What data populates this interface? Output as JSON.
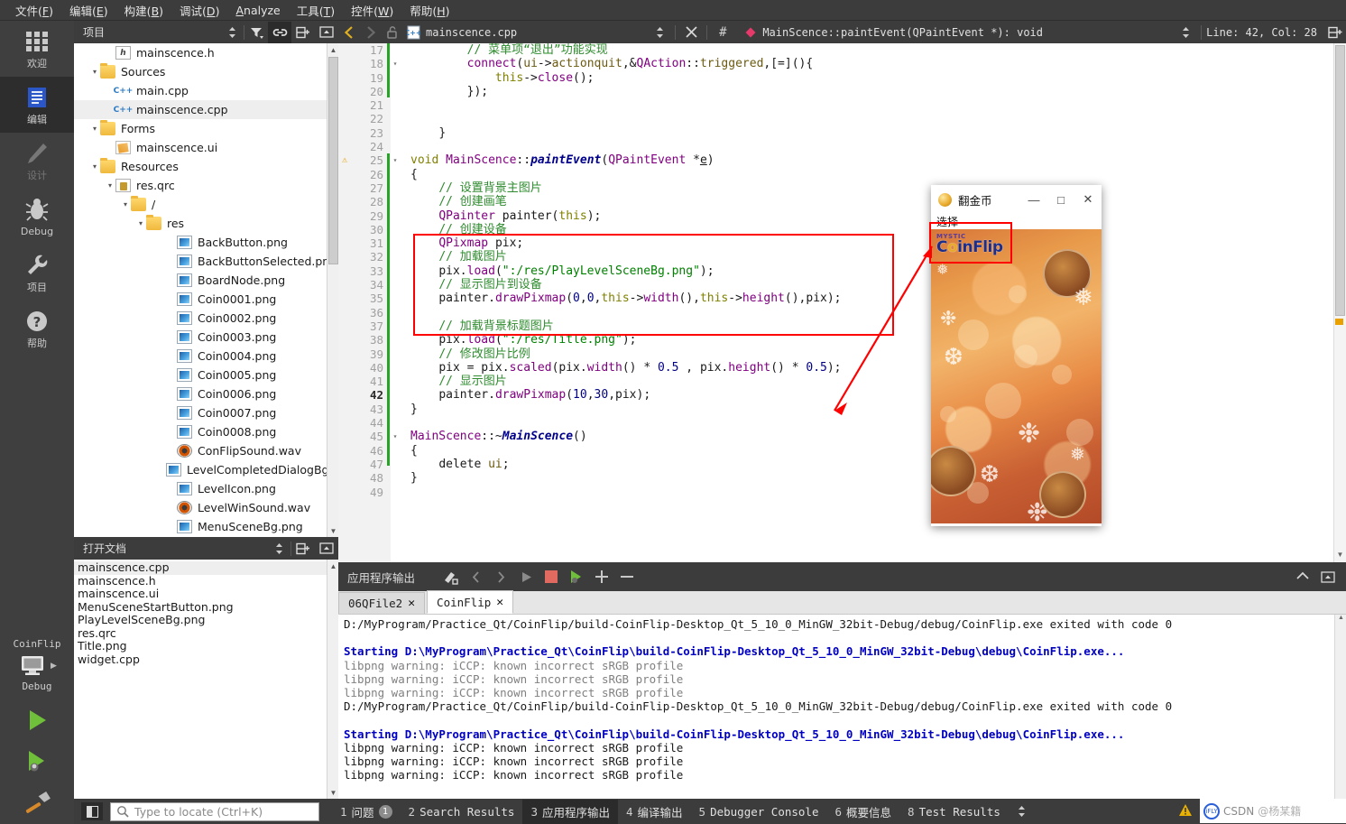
{
  "menubar": {
    "items": [
      {
        "label": "文件(F)",
        "accel": "F"
      },
      {
        "label": "编辑(E)",
        "accel": "E"
      },
      {
        "label": "构建(B)",
        "accel": "B"
      },
      {
        "label": "调试(D)",
        "accel": "D"
      },
      {
        "label": "Analyze",
        "accel": "A"
      },
      {
        "label": "工具(T)",
        "accel": "T"
      },
      {
        "label": "控件(W)",
        "accel": "W"
      },
      {
        "label": "帮助(H)",
        "accel": "H"
      }
    ]
  },
  "activitybar": {
    "items": [
      {
        "label": "欢迎",
        "icon": "grid-icon",
        "active": false,
        "dim": false
      },
      {
        "label": "编辑",
        "icon": "document-icon",
        "active": true,
        "dim": false
      },
      {
        "label": "设计",
        "icon": "pencil-icon",
        "active": false,
        "dim": true
      },
      {
        "label": "Debug",
        "icon": "bug-icon",
        "active": false,
        "dim": false
      },
      {
        "label": "项目",
        "icon": "wrench-icon",
        "active": false,
        "dim": false
      },
      {
        "label": "帮助",
        "icon": "question-icon",
        "active": false,
        "dim": false
      }
    ],
    "kit_name": "CoinFlip",
    "build_config": "Debug",
    "run_label": "run-button",
    "debug_label": "debug-button",
    "build_label": "build-button"
  },
  "project_panel": {
    "title": "项目",
    "tree": [
      {
        "indent": 2,
        "arrow": "",
        "icon": "header-icon",
        "label": "mainscence.h",
        "selected": false
      },
      {
        "indent": 1,
        "arrow": "▾",
        "icon": "folder-cpp-icon",
        "label": "Sources",
        "selected": false
      },
      {
        "indent": 2,
        "arrow": "",
        "icon": "cpp-icon",
        "label": "main.cpp",
        "selected": false
      },
      {
        "indent": 2,
        "arrow": "",
        "icon": "cpp-icon",
        "label": "mainscence.cpp",
        "selected": true
      },
      {
        "indent": 1,
        "arrow": "▾",
        "icon": "folder-form-icon",
        "label": "Forms",
        "selected": false
      },
      {
        "indent": 2,
        "arrow": "",
        "icon": "ui-icon",
        "label": "mainscence.ui",
        "selected": false
      },
      {
        "indent": 1,
        "arrow": "▾",
        "icon": "folder-res-icon",
        "label": "Resources",
        "selected": false
      },
      {
        "indent": 2,
        "arrow": "▾",
        "icon": "qrc-icon",
        "label": "res.qrc",
        "selected": false
      },
      {
        "indent": 3,
        "arrow": "▾",
        "icon": "folder-icon",
        "label": "/",
        "selected": false
      },
      {
        "indent": 4,
        "arrow": "▾",
        "icon": "folder-icon",
        "label": "res",
        "selected": false
      },
      {
        "indent": 6,
        "arrow": "",
        "icon": "png-icon",
        "label": "BackButton.png",
        "selected": false
      },
      {
        "indent": 6,
        "arrow": "",
        "icon": "png-icon",
        "label": "BackButtonSelected.png",
        "selected": false
      },
      {
        "indent": 6,
        "arrow": "",
        "icon": "png-icon",
        "label": "BoardNode.png",
        "selected": false
      },
      {
        "indent": 6,
        "arrow": "",
        "icon": "png-icon",
        "label": "Coin0001.png",
        "selected": false
      },
      {
        "indent": 6,
        "arrow": "",
        "icon": "png-icon",
        "label": "Coin0002.png",
        "selected": false
      },
      {
        "indent": 6,
        "arrow": "",
        "icon": "png-icon",
        "label": "Coin0003.png",
        "selected": false
      },
      {
        "indent": 6,
        "arrow": "",
        "icon": "png-icon",
        "label": "Coin0004.png",
        "selected": false
      },
      {
        "indent": 6,
        "arrow": "",
        "icon": "png-icon",
        "label": "Coin0005.png",
        "selected": false
      },
      {
        "indent": 6,
        "arrow": "",
        "icon": "png-icon",
        "label": "Coin0006.png",
        "selected": false
      },
      {
        "indent": 6,
        "arrow": "",
        "icon": "png-icon",
        "label": "Coin0007.png",
        "selected": false
      },
      {
        "indent": 6,
        "arrow": "",
        "icon": "png-icon",
        "label": "Coin0008.png",
        "selected": false
      },
      {
        "indent": 6,
        "arrow": "",
        "icon": "wav-icon",
        "label": "ConFlipSound.wav",
        "selected": false
      },
      {
        "indent": 6,
        "arrow": "",
        "icon": "png-icon",
        "label": "LevelCompletedDialogBg.png",
        "selected": false
      },
      {
        "indent": 6,
        "arrow": "",
        "icon": "png-icon",
        "label": "LevelIcon.png",
        "selected": false
      },
      {
        "indent": 6,
        "arrow": "",
        "icon": "wav-icon",
        "label": "LevelWinSound.wav",
        "selected": false
      },
      {
        "indent": 6,
        "arrow": "",
        "icon": "png-icon",
        "label": "MenuSceneBg.png",
        "selected": false
      }
    ]
  },
  "open_documents": {
    "title": "打开文档",
    "items": [
      {
        "label": "mainscence.cpp",
        "selected": true
      },
      {
        "label": "mainscence.h",
        "selected": false
      },
      {
        "label": "mainscence.ui",
        "selected": false
      },
      {
        "label": "MenuSceneStartButton.png",
        "selected": false
      },
      {
        "label": "PlayLevelSceneBg.png",
        "selected": false
      },
      {
        "label": "res.qrc",
        "selected": false
      },
      {
        "label": "Title.png",
        "selected": false
      },
      {
        "label": "widget.cpp",
        "selected": false
      }
    ]
  },
  "editor": {
    "file_name": "mainscence.cpp",
    "symbol": "MainScence::paintEvent(QPaintEvent *): void",
    "cursor": "Line: 42, Col: 28",
    "lines": [
      {
        "n": 17,
        "fold": "",
        "warn": false,
        "current": false,
        "html": "        <span class=\"cmt\">// 菜单项“退出”功能实现</span>"
      },
      {
        "n": 18,
        "fold": "▾",
        "warn": false,
        "current": false,
        "html": "        <span class=\"typ\">connect</span><span class=\"plain\">(</span><span class=\"var\">ui</span><span class=\"plain\">-&gt;</span><span class=\"var\">actionquit</span><span class=\"plain\">,&amp;</span><span class=\"cls\">QAction</span><span class=\"plain\">::</span><span class=\"var\">triggered</span><span class=\"plain\">,[=](){</span>"
      },
      {
        "n": 19,
        "fold": "",
        "warn": false,
        "current": false,
        "html": "            <span class=\"kw\">this</span><span class=\"plain\">-&gt;</span><span class=\"typ\">close</span><span class=\"plain\">();</span>"
      },
      {
        "n": 20,
        "fold": "",
        "warn": false,
        "current": false,
        "html": "        <span class=\"plain\">});</span>"
      },
      {
        "n": 21,
        "fold": "",
        "warn": false,
        "current": false,
        "html": ""
      },
      {
        "n": 22,
        "fold": "",
        "warn": false,
        "current": false,
        "html": ""
      },
      {
        "n": 23,
        "fold": "",
        "warn": false,
        "current": false,
        "html": "    <span class=\"plain\">}</span>"
      },
      {
        "n": 24,
        "fold": "",
        "warn": false,
        "current": false,
        "html": ""
      },
      {
        "n": 25,
        "fold": "▾",
        "warn": true,
        "current": false,
        "html": "<span class=\"kw\">void</span> <span class=\"cls\">MainScence</span><span class=\"plain\">::</span><span class=\"fnb\">paintEvent</span><span class=\"plain\">(</span><span class=\"cls\">QPaintEvent</span> <span class=\"plain\">*</span><span class=\"uline\">e</span><span class=\"plain\">)</span>"
      },
      {
        "n": 26,
        "fold": "",
        "warn": false,
        "current": false,
        "html": "<span class=\"plain\">{</span>"
      },
      {
        "n": 27,
        "fold": "",
        "warn": false,
        "current": false,
        "html": "    <span class=\"cmt\">// 设置背景主图片</span>"
      },
      {
        "n": 28,
        "fold": "",
        "warn": false,
        "current": false,
        "html": "    <span class=\"cmt\">// 创建画笔</span>"
      },
      {
        "n": 29,
        "fold": "",
        "warn": false,
        "current": false,
        "html": "    <span class=\"cls\">QPainter</span> <span class=\"plain\">painter(</span><span class=\"kw\">this</span><span class=\"plain\">);</span>"
      },
      {
        "n": 30,
        "fold": "",
        "warn": false,
        "current": false,
        "html": "    <span class=\"cmt\">// 创建设备</span>"
      },
      {
        "n": 31,
        "fold": "",
        "warn": false,
        "current": false,
        "html": "    <span class=\"cls\">QPixmap</span> <span class=\"plain\">pix;</span>"
      },
      {
        "n": 32,
        "fold": "",
        "warn": false,
        "current": false,
        "html": "    <span class=\"cmt\">// 加载图片</span>"
      },
      {
        "n": 33,
        "fold": "",
        "warn": false,
        "current": false,
        "html": "    <span class=\"plain\">pix.</span><span class=\"typ\">load</span><span class=\"plain\">(</span><span class=\"str\">\":/res/PlayLevelSceneBg.png\"</span><span class=\"plain\">);</span>"
      },
      {
        "n": 34,
        "fold": "",
        "warn": false,
        "current": false,
        "html": "    <span class=\"cmt\">// 显示图片到设备</span>"
      },
      {
        "n": 35,
        "fold": "",
        "warn": false,
        "current": false,
        "html": "    <span class=\"plain\">painter.</span><span class=\"typ\">drawPixmap</span><span class=\"plain\">(</span><span class=\"num\">0</span><span class=\"plain\">,</span><span class=\"num\">0</span><span class=\"plain\">,</span><span class=\"kw\">this</span><span class=\"plain\">-&gt;</span><span class=\"typ\">width</span><span class=\"plain\">(),</span><span class=\"kw\">this</span><span class=\"plain\">-&gt;</span><span class=\"typ\">height</span><span class=\"plain\">(),pix);</span>"
      },
      {
        "n": 36,
        "fold": "",
        "warn": false,
        "current": false,
        "html": ""
      },
      {
        "n": 37,
        "fold": "",
        "warn": false,
        "current": false,
        "html": "    <span class=\"cmt\">// 加载背景标题图片</span>"
      },
      {
        "n": 38,
        "fold": "",
        "warn": false,
        "current": false,
        "html": "    <span class=\"plain\">pix.</span><span class=\"typ\">load</span><span class=\"plain\">(</span><span class=\"str\">\":/res/Title.png\"</span><span class=\"plain\">);</span>"
      },
      {
        "n": 39,
        "fold": "",
        "warn": false,
        "current": false,
        "html": "    <span class=\"cmt\">// 修改图片比例</span>"
      },
      {
        "n": 40,
        "fold": "",
        "warn": false,
        "current": false,
        "html": "    <span class=\"plain\">pix = pix.</span><span class=\"typ\">scaled</span><span class=\"plain\">(pix.</span><span class=\"typ\">width</span><span class=\"plain\">() * </span><span class=\"num\">0.5</span><span class=\"plain\"> , pix.</span><span class=\"typ\">height</span><span class=\"plain\">() * </span><span class=\"num\">0.5</span><span class=\"plain\">);</span>"
      },
      {
        "n": 41,
        "fold": "",
        "warn": false,
        "current": false,
        "html": "    <span class=\"cmt\">// 显示图片</span>"
      },
      {
        "n": 42,
        "fold": "",
        "warn": false,
        "current": true,
        "html": "    <span class=\"plain\">painter.</span><span class=\"typ\">drawPixmap</span><span class=\"plain\">(</span><span class=\"num\">10</span><span class=\"plain\">,</span><span class=\"num\">30</span><span class=\"plain\">,pix);</span>"
      },
      {
        "n": 43,
        "fold": "",
        "warn": false,
        "current": false,
        "html": "<span class=\"plain\">}</span>"
      },
      {
        "n": 44,
        "fold": "",
        "warn": false,
        "current": false,
        "html": ""
      },
      {
        "n": 45,
        "fold": "▾",
        "warn": false,
        "current": false,
        "html": "<span class=\"cls\">MainScence</span><span class=\"plain\">::~</span><span class=\"fnb\">MainScence</span><span class=\"plain\">()</span>"
      },
      {
        "n": 46,
        "fold": "",
        "warn": false,
        "current": false,
        "html": "<span class=\"plain\">{</span>"
      },
      {
        "n": 47,
        "fold": "",
        "warn": false,
        "current": false,
        "html": "    <span class=\"plain\">delete </span><span class=\"var\">ui</span><span class=\"plain\">;</span>"
      },
      {
        "n": 48,
        "fold": "",
        "warn": false,
        "current": false,
        "html": "<span class=\"plain\">}</span>"
      },
      {
        "n": 49,
        "fold": "",
        "warn": false,
        "current": false,
        "html": ""
      }
    ]
  },
  "output_pane": {
    "title": "应用程序输出",
    "tabs": [
      {
        "label": "06QFile2",
        "active": false
      },
      {
        "label": "CoinFlip",
        "active": true
      }
    ],
    "lines": [
      {
        "text": "D:/MyProgram/Practice_Qt/CoinFlip/build-CoinFlip-Desktop_Qt_5_10_0_MinGW_32bit-Debug/debug/CoinFlip.exe exited with code 0",
        "style": "normal"
      },
      {
        "text": "",
        "style": "normal"
      },
      {
        "text": "Starting D:\\MyProgram\\Practice_Qt\\CoinFlip\\build-CoinFlip-Desktop_Qt_5_10_0_MinGW_32bit-Debug\\debug\\CoinFlip.exe...",
        "style": "blue"
      },
      {
        "text": "libpng warning: iCCP: known incorrect sRGB profile",
        "style": "gray"
      },
      {
        "text": "libpng warning: iCCP: known incorrect sRGB profile",
        "style": "gray"
      },
      {
        "text": "libpng warning: iCCP: known incorrect sRGB profile",
        "style": "gray"
      },
      {
        "text": "D:/MyProgram/Practice_Qt/CoinFlip/build-CoinFlip-Desktop_Qt_5_10_0_MinGW_32bit-Debug/debug/CoinFlip.exe exited with code 0",
        "style": "normal"
      },
      {
        "text": "",
        "style": "normal"
      },
      {
        "text": "Starting D:\\MyProgram\\Practice_Qt\\CoinFlip\\build-CoinFlip-Desktop_Qt_5_10_0_MinGW_32bit-Debug\\debug\\CoinFlip.exe...",
        "style": "blue"
      },
      {
        "text": "libpng warning: iCCP: known incorrect sRGB profile",
        "style": "normal"
      },
      {
        "text": "libpng warning: iCCP: known incorrect sRGB profile",
        "style": "normal"
      },
      {
        "text": "libpng warning: iCCP: known incorrect sRGB profile",
        "style": "normal"
      }
    ]
  },
  "statusbar": {
    "locate_placeholder": "Type to locate (Ctrl+K)",
    "items": [
      {
        "num": "1",
        "label": "问题",
        "badge": "1",
        "active": false
      },
      {
        "num": "2",
        "label": "Search Results",
        "badge": "",
        "active": false
      },
      {
        "num": "3",
        "label": "应用程序输出",
        "badge": "",
        "active": true
      },
      {
        "num": "4",
        "label": "编译输出",
        "badge": "",
        "active": false
      },
      {
        "num": "5",
        "label": "Debugger Console",
        "badge": "",
        "active": false
      },
      {
        "num": "6",
        "label": "概要信息",
        "badge": "",
        "active": false
      },
      {
        "num": "8",
        "label": "Test Results",
        "badge": "",
        "active": false
      }
    ]
  },
  "app_window": {
    "title": "翻金币",
    "menu": "选择",
    "minimize": "—",
    "maximize": "□",
    "close": "✕",
    "game_title_top": "MYSTIC",
    "game_title_main": "CoinFlip"
  },
  "watermark": {
    "badge": "iFLY",
    "text": "CSDN",
    "text2": "@杨某籍"
  },
  "colors": {
    "chrome": "#3c3c3c",
    "accent_red": "#ff0000",
    "editor_bg": "#ffffff",
    "green_change_bar": "#27a327",
    "blue_output": "#0000c0"
  }
}
